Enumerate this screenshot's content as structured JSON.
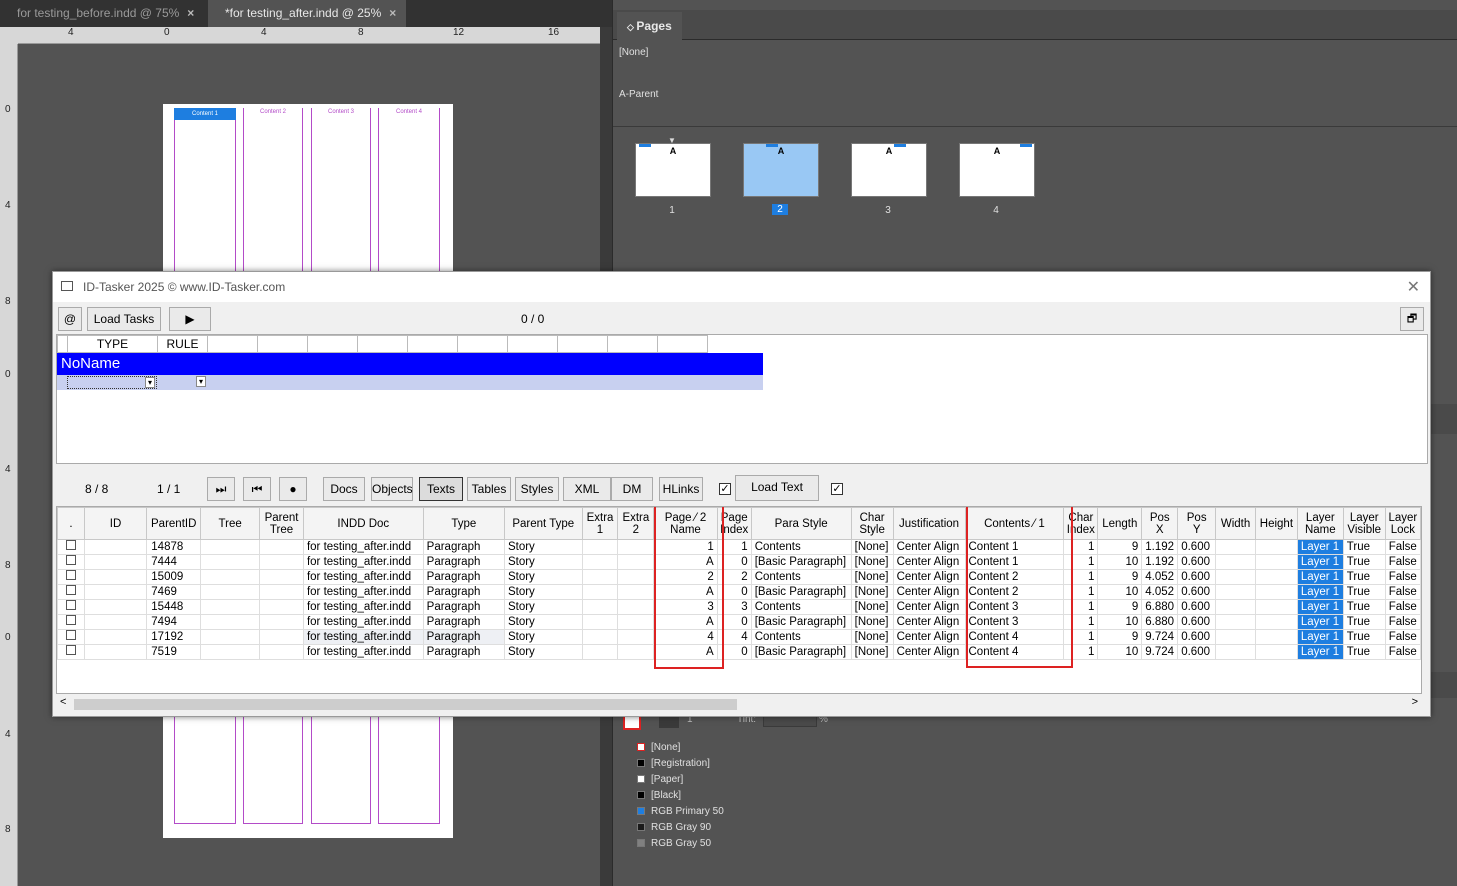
{
  "tabs": [
    {
      "label": "for testing_before.indd @ 75%",
      "close": "×"
    },
    {
      "label": "*for testing_after.indd @ 25%",
      "close": "×"
    }
  ],
  "ruler_h": [
    "4",
    "0",
    "4",
    "8",
    "12",
    "16"
  ],
  "ruler_v": [
    "0",
    "4",
    "8",
    "0",
    "4",
    "8",
    "0",
    "4",
    "8"
  ],
  "frame_labels": [
    "Content 1",
    "Content 2",
    "Content 3",
    "Content 4"
  ],
  "pages_panel": {
    "tab": "Pages",
    "none": "[None]",
    "parent": "A-Parent",
    "thumb_letter": "A",
    "page_numbers": [
      "1",
      "2",
      "3",
      "4"
    ],
    "selected": "2"
  },
  "swatches": {
    "tint_label": "Tint:",
    "tint_unit": "%",
    "stroke_value": "1",
    "items": [
      {
        "name": "[None]",
        "color": "#ffffff"
      },
      {
        "name": "[Registration]",
        "color": "#000000"
      },
      {
        "name": "[Paper]",
        "color": "#ffffff"
      },
      {
        "name": "[Black]",
        "color": "#000000"
      },
      {
        "name": "RGB Primary 50",
        "color": "#1e7ee0"
      },
      {
        "name": "RGB Gray 90",
        "color": "#1a1a1a"
      },
      {
        "name": "RGB Gray 50",
        "color": "#808080"
      }
    ]
  },
  "dialog": {
    "title": "ID-Tasker 2025  © www.ID-Tasker.com",
    "close": "✕",
    "at_button": "@",
    "load_tasks": "Load Tasks",
    "play": "▶",
    "counter": "0 / 0",
    "restore": "🗗",
    "task_headers": [
      "TYPE",
      "RULE"
    ],
    "task_name": "NoName",
    "dropdown": "▾",
    "nav": {
      "count1": "8 / 8",
      "count2": "1 / 1",
      "last": "⏭",
      "first": "⏮",
      "record": "●"
    },
    "filters": [
      "Docs",
      "Objects",
      "Texts",
      "Tables",
      "Styles",
      "XML",
      "DM",
      "HLinks"
    ],
    "active_filter": "Texts",
    "load_text": "Load Text",
    "check": "✓",
    "scroll_left": "<",
    "scroll_right": ">",
    "columns": [
      ".",
      "ID",
      "ParentID",
      "Tree",
      "Parent\nTree",
      "INDD Doc",
      "Type",
      "Parent Type",
      "Extra\n1",
      "Extra\n2",
      "Page  ⁄  2\nName",
      "Page\nIndex",
      "Para Style",
      "Char\nStyle",
      "Justification",
      "Contents   ⁄  1",
      "Char\nIndex",
      "Length",
      "Pos\nX",
      "Pos\nY",
      "Width",
      "Height",
      "Layer\nName",
      "Layer\nVisible",
      "Layer\nLock"
    ],
    "rows": [
      [
        "",
        "",
        "14878",
        "",
        "",
        "for testing_after.indd",
        "Paragraph",
        "Story",
        "",
        "",
        "1",
        "1",
        "Contents",
        "[None]",
        "Center Align",
        "Content 1",
        "1",
        "9",
        "1.192",
        "0.600",
        "",
        "",
        "Layer 1",
        "True",
        "False"
      ],
      [
        "",
        "",
        "7444",
        "",
        "",
        "for testing_after.indd",
        "Paragraph",
        "Story",
        "",
        "",
        "A",
        "0",
        "[Basic Paragraph]",
        "[None]",
        "Center Align",
        "Content 1",
        "1",
        "10",
        "1.192",
        "0.600",
        "",
        "",
        "Layer 1",
        "True",
        "False"
      ],
      [
        "",
        "",
        "15009",
        "",
        "",
        "for testing_after.indd",
        "Paragraph",
        "Story",
        "",
        "",
        "2",
        "2",
        "Contents",
        "[None]",
        "Center Align",
        "Content 2",
        "1",
        "9",
        "4.052",
        "0.600",
        "",
        "",
        "Layer 1",
        "True",
        "False"
      ],
      [
        "",
        "",
        "7469",
        "",
        "",
        "for testing_after.indd",
        "Paragraph",
        "Story",
        "",
        "",
        "A",
        "0",
        "[Basic Paragraph]",
        "[None]",
        "Center Align",
        "Content 2",
        "1",
        "10",
        "4.052",
        "0.600",
        "",
        "",
        "Layer 1",
        "True",
        "False"
      ],
      [
        "",
        "",
        "15448",
        "",
        "",
        "for testing_after.indd",
        "Paragraph",
        "Story",
        "",
        "",
        "3",
        "3",
        "Contents",
        "[None]",
        "Center Align",
        "Content 3",
        "1",
        "9",
        "6.880",
        "0.600",
        "",
        "",
        "Layer 1",
        "True",
        "False"
      ],
      [
        "",
        "",
        "7494",
        "",
        "",
        "for testing_after.indd",
        "Paragraph",
        "Story",
        "",
        "",
        "A",
        "0",
        "[Basic Paragraph]",
        "[None]",
        "Center Align",
        "Content 3",
        "1",
        "10",
        "6.880",
        "0.600",
        "",
        "",
        "Layer 1",
        "True",
        "False"
      ],
      [
        "",
        "",
        "17192",
        "",
        "",
        "for testing_after.indd",
        "Paragraph",
        "Story",
        "",
        "",
        "4",
        "4",
        "Contents",
        "[None]",
        "Center Align",
        "Content 4",
        "1",
        "9",
        "9.724",
        "0.600",
        "",
        "",
        "Layer 1",
        "True",
        "False"
      ],
      [
        "",
        "",
        "7519",
        "",
        "",
        "for testing_after.indd",
        "Paragraph",
        "Story",
        "",
        "",
        "A",
        "0",
        "[Basic Paragraph]",
        "[None]",
        "Center Align",
        "Content 4",
        "1",
        "10",
        "9.724",
        "0.600",
        "",
        "",
        "Layer 1",
        "True",
        "False"
      ]
    ]
  }
}
